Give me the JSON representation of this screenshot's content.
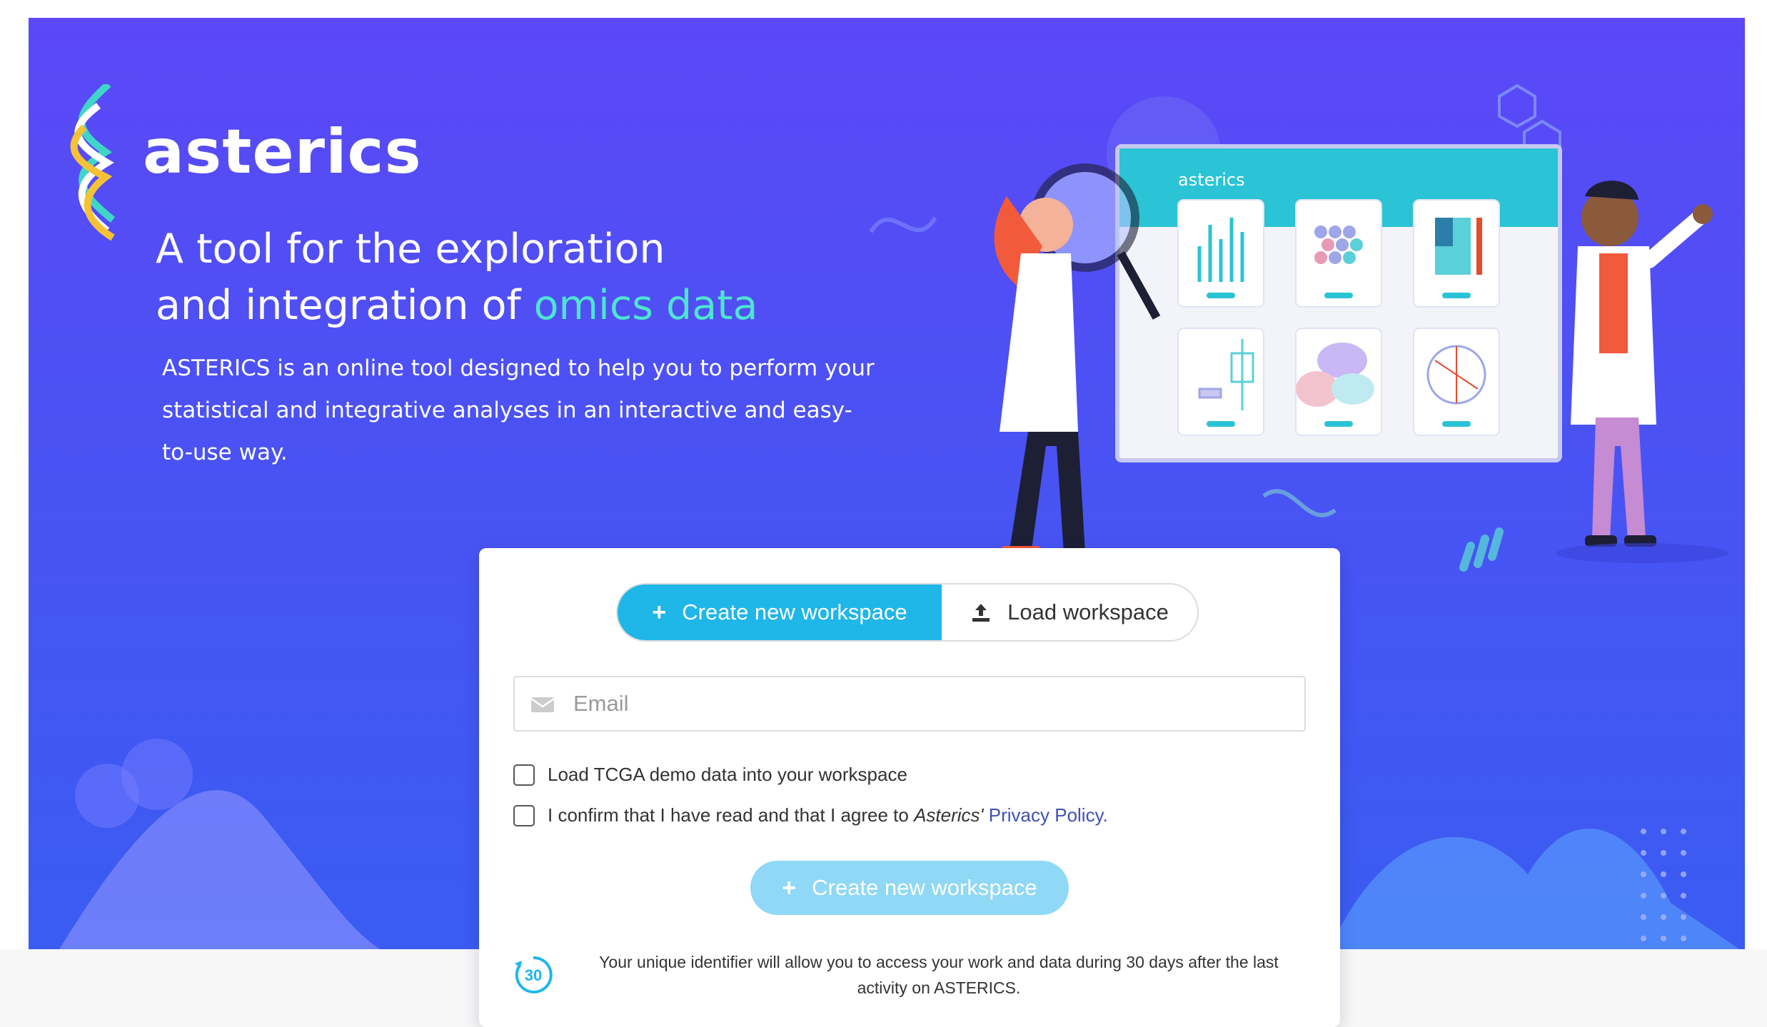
{
  "brand": {
    "name": "asterics"
  },
  "hero": {
    "headline_line1": "A tool for the exploration",
    "headline_line2_prefix": "and integration of ",
    "headline_line2_accent": "omics data",
    "description": "ASTERICS is an online tool designed to help you to perform your statistical and integrative analyses in an interactive and easy-to-use way."
  },
  "illustration": {
    "screen_title": "asterics"
  },
  "workspace_card": {
    "tabs": [
      {
        "label": "Create new workspace",
        "icon": "plus-icon",
        "active": true
      },
      {
        "label": "Load workspace",
        "icon": "upload-icon",
        "active": false
      }
    ],
    "email": {
      "placeholder": "Email",
      "value": "",
      "icon": "envelope-icon"
    },
    "checkbox_demo": {
      "label": "Load TCGA demo data into your workspace",
      "checked": false
    },
    "checkbox_privacy": {
      "label_prefix": "I confirm that I have read and that I agree to ",
      "label_italic": "Asterics'",
      "link_text": "Privacy Policy.",
      "checked": false
    },
    "submit_button": {
      "label": "Create new workspace",
      "icon": "plus-icon",
      "disabled": true
    },
    "retention_note": {
      "icon": "30-days-icon",
      "icon_text": "30",
      "text": "Your unique identifier will allow you to access your work and data during 30 days after the last activity on ASTERICS."
    }
  },
  "colors": {
    "hero_bg": "#5b48f6",
    "accent_cyan": "#1fb6e8",
    "accent_teal": "#4ee4d0",
    "link": "#3f51b5",
    "disabled_button": "#8fd8f6"
  }
}
